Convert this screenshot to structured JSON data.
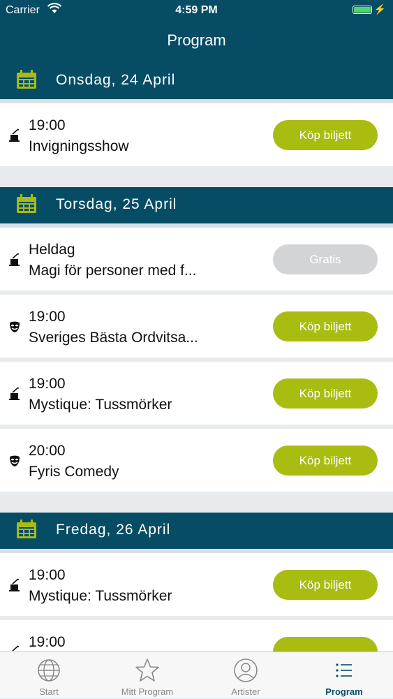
{
  "status": {
    "carrier": "Carrier",
    "time": "4:59 PM"
  },
  "nav": {
    "title": "Program"
  },
  "days": [
    {
      "label": "Onsdag, 24 April"
    },
    {
      "label": "Torsdag, 25 April"
    },
    {
      "label": "Fredag, 26 April"
    }
  ],
  "events": [
    {
      "time": "19:00",
      "title": "Invigningsshow",
      "button": "Köp biljett",
      "icon": "magic-hat-icon"
    },
    {
      "time": "Heldag",
      "title": "Magi för personer med f...",
      "button": "Gratis",
      "icon": "magic-hat-icon"
    },
    {
      "time": "19:00",
      "title": "Sveriges Bästa Ordvitsa...",
      "button": "Köp biljett",
      "icon": "theater-mask-icon"
    },
    {
      "time": "19:00",
      "title": "Mystique: Tussmörker",
      "button": "Köp biljett",
      "icon": "magic-hat-icon"
    },
    {
      "time": "20:00",
      "title": "Fyris Comedy",
      "button": "Köp biljett",
      "icon": "theater-mask-icon"
    },
    {
      "time": "19:00",
      "title": "Mystique: Tussmörker",
      "button": "Köp biljett",
      "icon": "magic-hat-icon"
    },
    {
      "time": "19:00",
      "title": "",
      "button": "",
      "icon": "magic-hat-icon"
    }
  ],
  "tabs": [
    {
      "label": "Start",
      "icon": "globe-icon"
    },
    {
      "label": "Mitt Program",
      "icon": "star-icon"
    },
    {
      "label": "Artister",
      "icon": "person-icon"
    },
    {
      "label": "Program",
      "icon": "list-icon"
    }
  ],
  "colors": {
    "header": "#064c65",
    "accent": "#a9bc10",
    "free_button": "#d3d4d6",
    "calendar_icon": "#a9bc10"
  }
}
